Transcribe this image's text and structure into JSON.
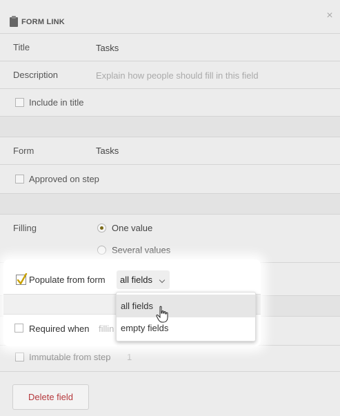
{
  "header": {
    "title": "FORM LINK",
    "close_symbol": "×"
  },
  "fields": {
    "title": {
      "label": "Title",
      "value": "Tasks"
    },
    "description": {
      "label": "Description",
      "placeholder": "Explain how people should fill in this field"
    },
    "include_in_title": {
      "label": "Include in title",
      "checked": false
    },
    "form": {
      "label": "Form",
      "value": "Tasks"
    },
    "approved_on_step": {
      "label": "Approved on step",
      "checked": false
    },
    "filling": {
      "label": "Filling",
      "options": [
        "One value",
        "Several values"
      ],
      "selected": "One value"
    },
    "populate_from_form": {
      "label": "Populate from form",
      "checked": true,
      "selected": "all fields"
    },
    "required_when": {
      "label": "Required when",
      "placeholder": "fillin"
    },
    "immutable_from_step": {
      "label": "Immutable from step",
      "value": "1"
    }
  },
  "dropdown": {
    "options": [
      "all fields",
      "empty fields"
    ],
    "highlighted": "all fields"
  },
  "actions": {
    "delete_label": "Delete field"
  },
  "colors": {
    "accent_check": "#c8a000",
    "radio_dot": "#7a6a18",
    "delete_text": "#b5383c"
  }
}
